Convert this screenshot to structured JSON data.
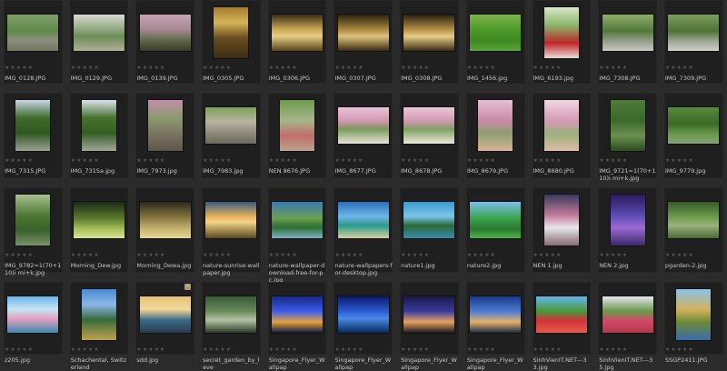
{
  "colors": {
    "background": "#2b2b2b",
    "cell": "#1f1f1f",
    "text": "#c8c8c8",
    "stars": "#555555"
  },
  "stars_glyph": "★★★★★",
  "items": [
    {
      "name": "IMG_0128.JPG",
      "shape": "l",
      "img": "linear-gradient(180deg,#7fa06a 0%,#5f8a4c 45%,#8c8f7c 70%,#6f7a5e 100%)"
    },
    {
      "name": "IMG_0129.JPG",
      "shape": "l",
      "img": "linear-gradient(180deg,#d9dbd2 0%,#9bb08a 35%,#6d8d55 60%,#b3ad98 100%)"
    },
    {
      "name": "IMG_0139.JPG",
      "shape": "l",
      "img": "linear-gradient(180deg,#c7a3b1 0%,#a88a93 40%,#5e6b4a 70%,#3c3a2d 100%)"
    },
    {
      "name": "IMG_0305.JPG",
      "shape": "p",
      "img": "linear-gradient(180deg,#a57b30 0%,#d6b45a 30%,#6a4d1f 60%,#3a2b14 100%)"
    },
    {
      "name": "IMG_0306.JPG",
      "shape": "l",
      "img": "linear-gradient(180deg,#3a2d14 0%,#c9a653 40%,#e3cc84 60%,#5a4320 100%)"
    },
    {
      "name": "IMG_0307.JPG",
      "shape": "l",
      "img": "linear-gradient(180deg,#2c2210 0%,#a8873d 40%,#dcc27e 60%,#3b2c12 100%)"
    },
    {
      "name": "IMG_0308.JPG",
      "shape": "l",
      "img": "linear-gradient(180deg,#2a2010 0%,#b28d42 40%,#e6cd88 60%,#3b2c12 100%)"
    },
    {
      "name": "IMG_1456.jpg",
      "shape": "l",
      "img": "linear-gradient(180deg,#7bb34b 0%,#4e9a2b 40%,#3d8a22 70%,#5aa335 100%)"
    },
    {
      "name": "IMG_6193.jpg",
      "shape": "p",
      "img": "linear-gradient(180deg,#d9e7c6 0%,#8db56a 35%,#c0262a 70%,#e6e0d8 100%)"
    },
    {
      "name": "IMG_7308.JPG",
      "shape": "l",
      "img": "linear-gradient(180deg,#8fae6a 0%,#53783a 45%,#9aa092 75%,#c8c8bf 100%)"
    },
    {
      "name": "IMG_7309.JPG",
      "shape": "l",
      "img": "linear-gradient(180deg,#7e9e5e 0%,#4f7236 45%,#a3a89a 75%,#cfcfc6 100%)"
    },
    {
      "name": "IMG_7315.JPG",
      "shape": "p",
      "img": "linear-gradient(180deg,#c9d6e3 0%,#3f6a2a 35%,#2f5720 65%,#9aa094 100%)"
    },
    {
      "name": "IMG_7315a.jpg",
      "shape": "p",
      "img": "linear-gradient(180deg,#dbe3ea 0%,#46722e 35%,#355e24 65%,#a2a69a 100%)"
    },
    {
      "name": "IMG_7973.jpg",
      "shape": "p",
      "img": "linear-gradient(180deg,#c28ea6 0%,#8a9a6e 35%,#7c7664 65%,#5a5548 100%)"
    },
    {
      "name": "IMG_7983.jpg",
      "shape": "l",
      "img": "linear-gradient(180deg,#7da05c 0%,#b9b4a0 40%,#8e8a7a 70%,#6e6a5c 100%)"
    },
    {
      "name": "NEN 8676.JPG",
      "shape": "p",
      "img": "linear-gradient(180deg,#6f9a4e 0%,#a7b58a 40%,#c26e6a 70%,#b9a490 100%)"
    },
    {
      "name": "IMG_8677.JPG",
      "shape": "l",
      "img": "linear-gradient(180deg,#e6c3d4 0%,#d79ab6 35%,#7a9a5c 60%,#e8e3da 100%)"
    },
    {
      "name": "IMG_8678.JPG",
      "shape": "l",
      "img": "linear-gradient(180deg,#e9c8d8 0%,#d69ab5 35%,#80a062 60%,#ebe6dd 100%)"
    },
    {
      "name": "IMG_8679.JPG",
      "shape": "p",
      "img": "linear-gradient(180deg,#e6c0d2 0%,#c98aa6 40%,#8e9e70 65%,#d9b49a 100%)"
    },
    {
      "name": "IMG_8680.JPG",
      "shape": "p",
      "img": "linear-gradient(180deg,#f0d6e2 0%,#d59ab6 40%,#9bb07a 65%,#e0bca6 100%)"
    },
    {
      "name": "IMG_9721=1(70+110)i mi+k.jpg",
      "shape": "p",
      "img": "linear-gradient(180deg,#4f7b3a 0%,#3a6a2a 40%,#6d8f52 70%,#2c4a20 100%)"
    },
    {
      "name": "IMG_9779.jpg",
      "shape": "l",
      "img": "linear-gradient(180deg,#5a8a3e 0%,#3b6a28 45%,#6b9a4c 75%,#8aa27a 100%)"
    },
    {
      "name": "IMG_9782=1(70+110)i mi+k.jpg",
      "shape": "p",
      "img": "linear-gradient(180deg,#a9c08e 0%,#4e7a34 40%,#38602a 70%,#7a936a 100%)"
    },
    {
      "name": "Morning_Dew.jpg",
      "shape": "l",
      "img": "linear-gradient(180deg,#1c2a16 0%,#5a7a2c 45%,#a8c25a 75%,#d9e29a 100%)"
    },
    {
      "name": "Morning_Dewa.jpg",
      "shape": "l",
      "img": "linear-gradient(180deg,#2a2a1c 0%,#8a7a42 45%,#c9b472 75%,#e6d79a 100%)"
    },
    {
      "name": "nature-sunrise-wallpaper.jpg",
      "shape": "l",
      "img": "linear-gradient(180deg,#3b5a7a 0%,#e6b25a 40%,#f3d58a 55%,#5a4a22 100%)"
    },
    {
      "name": "nature-wallpaper-download-free-for-pc.jpg",
      "shape": "l",
      "img": "linear-gradient(180deg,#3a7ab2 0%,#6aa04e 45%,#2e6e3a 70%,#7fb0c2 100%)"
    },
    {
      "name": "nature-wallpapers-for-desktop.jpg",
      "shape": "l",
      "img": "linear-gradient(180deg,#2b6fb8 0%,#6fb6e6 40%,#2a9a8a 65%,#d9cfa0 100%)"
    },
    {
      "name": "nature1.jpg",
      "shape": "l",
      "img": "linear-gradient(180deg,#3a9ad2 0%,#7ec6e6 40%,#2a6a3a 65%,#3a8ab2 100%)"
    },
    {
      "name": "nature2.jpg",
      "shape": "l",
      "img": "linear-gradient(180deg,#7ec0e8 0%,#3aa24a 45%,#2a7a2e 75%,#52b24a 100%)"
    },
    {
      "name": "NEN 1.jpg",
      "shape": "p",
      "img": "linear-gradient(180deg,#3a3a5a 0%,#c07a9a 40%,#e6e6ea 65%,#8a6a72 100%)"
    },
    {
      "name": "NEN 2.jpg",
      "shape": "p",
      "img": "linear-gradient(180deg,#2a1a5a 0%,#5a4ab2 40%,#9a6ad2 65%,#3a2a6a 100%)"
    },
    {
      "name": "pgarden-2.jpg",
      "shape": "l",
      "img": "linear-gradient(180deg,#3a5a2a 0%,#6a9a4a 40%,#9ab27a 65%,#4a6a3a 100%)"
    },
    {
      "name": "z205.jpg",
      "shape": "l",
      "img": "linear-gradient(180deg,#6ab2e6 0%,#c6e6f6 35%,#e6a2c2 60%,#3a8ab2 100%)"
    },
    {
      "name": "Schachental, Switzerland",
      "shape": "p",
      "img": "linear-gradient(180deg,#4a8ad2 0%,#8ab6e6 30%,#3a6a3a 60%,#c2a24a 100%)"
    },
    {
      "name": "sdd.jpg",
      "shape": "l",
      "img": "linear-gradient(180deg,#e6c27a 0%,#f3d89a 35%,#3a6a8a 65%,#2a3a4a 100%)",
      "lock": true
    },
    {
      "name": "secret_garden_by_leve",
      "shape": "l",
      "img": "linear-gradient(180deg,#3a5a3a 0%,#6a8a5a 40%,#b2c2a2 65%,#2a3a2a 100%)"
    },
    {
      "name": "Singapore_Flyer_Wallpap",
      "shape": "l",
      "img": "linear-gradient(180deg,#1a2a8a 0%,#3a5ae6 40%,#e6a23a 70%,#0a1a4a 100%)"
    },
    {
      "name": "Singapore_Flyer_Wallpap",
      "shape": "l",
      "img": "linear-gradient(180deg,#0a1a6a 0%,#2a5ad2 40%,#4a8ae6 60%,#0a2a5a 100%)"
    },
    {
      "name": "Singapore_Flyer_Wallpap",
      "shape": "l",
      "img": "linear-gradient(180deg,#1a1a4a 0%,#3a3a9a 40%,#e6a25a 70%,#1a1a2a 100%)"
    },
    {
      "name": "Singapore_Flyer_Wallpap",
      "shape": "l",
      "img": "linear-gradient(180deg,#1a3a8a 0%,#4a7ad2 40%,#e6b26a 70%,#1a2a4a 100%)"
    },
    {
      "name": "SinhVienIT.NET---33.jpg",
      "shape": "l",
      "img": "linear-gradient(180deg,#6ab2e6 0%,#4a9a3a 40%,#d2323a 65%,#e65a4a 100%)"
    },
    {
      "name": "SinhVienIT.NET---35.jpg",
      "shape": "l",
      "img": "linear-gradient(180deg,#e6e6f0 0%,#6a9a4a 40%,#d24a6a 65%,#b23a4a 100%)"
    },
    {
      "name": "SSGP2411.JPG",
      "shape": "p",
      "img": "linear-gradient(180deg,#8ac2e6 0%,#d2b25a 40%,#6a8a3a 65%,#3a6ab2 100%)"
    }
  ]
}
